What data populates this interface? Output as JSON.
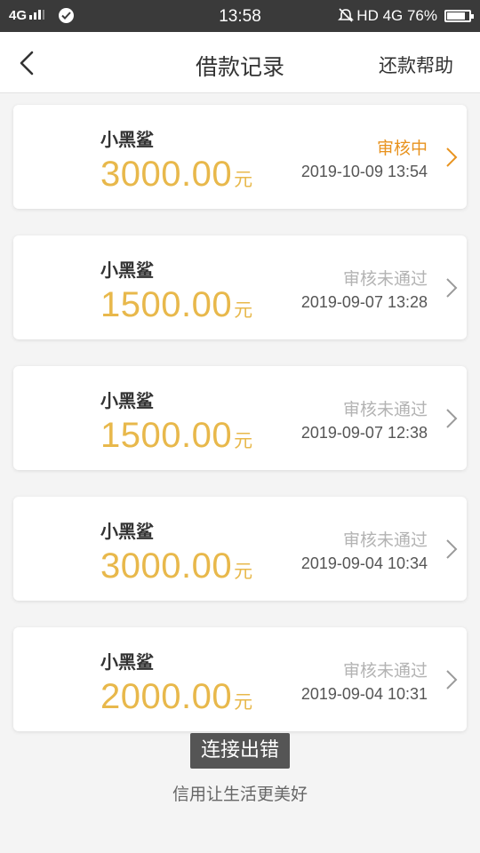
{
  "status_bar": {
    "signal": "4G",
    "time": "13:58",
    "right_text": "HD 4G 76%"
  },
  "nav": {
    "title": "借款记录",
    "help_label": "还款帮助"
  },
  "records": [
    {
      "name": "小黑鲨",
      "amount": "3000.00",
      "unit": "元",
      "status": "审核中",
      "date": "2019-10-09 13:54"
    },
    {
      "name": "小黑鲨",
      "amount": "1500.00",
      "unit": "元",
      "status": "审核未通过",
      "date": "2019-09-07 13:28"
    },
    {
      "name": "小黑鲨",
      "amount": "1500.00",
      "unit": "元",
      "status": "审核未通过",
      "date": "2019-09-07 12:38"
    },
    {
      "name": "小黑鲨",
      "amount": "3000.00",
      "unit": "元",
      "status": "审核未通过",
      "date": "2019-09-04 10:34"
    },
    {
      "name": "小黑鲨",
      "amount": "2000.00",
      "unit": "元",
      "status": "审核未通过",
      "date": "2019-09-04 10:31"
    }
  ],
  "toast": "连接出错",
  "footer": "信用让生活更美好",
  "colors": {
    "amount": "#e8b84b",
    "pending": "#e8931f",
    "rejected": "#b3b3b3"
  }
}
